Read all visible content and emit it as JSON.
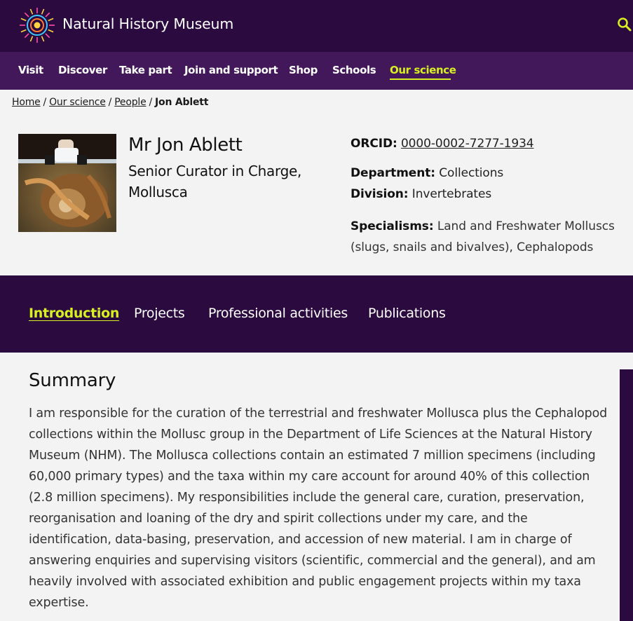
{
  "header": {
    "site_title": "Natural History Museum",
    "logo_icon": "nhm-starburst-logo-icon",
    "search_icon": "search-icon",
    "accent_color": "#d6f022",
    "bg_color": "#2a0a3f"
  },
  "nav": {
    "items": [
      {
        "label": "Visit"
      },
      {
        "label": "Discover"
      },
      {
        "label": "Take part"
      },
      {
        "label": "Join and support"
      },
      {
        "label": "Shop"
      },
      {
        "label": "Schools"
      },
      {
        "label": "Our science",
        "active": true
      }
    ]
  },
  "breadcrumb": {
    "items": [
      "Home",
      "Our science",
      "People"
    ],
    "current": "Jon Ablett"
  },
  "profile": {
    "name": "Mr Jon Ablett",
    "role": "Senior Curator in Charge, Mollusca",
    "orcid_label": "ORCID:",
    "orcid": "0000-0002-7277-1934",
    "department_label": "Department:",
    "department": "Collections",
    "division_label": "Division:",
    "division": "Invertebrates",
    "specialisms_label": "Specialisms:",
    "specialisms": "Land and Freshwater Molluscs (slugs, snails and bivalves), Cephalopods"
  },
  "tabs": [
    {
      "label": "Introduction",
      "active": true
    },
    {
      "label": "Projects"
    },
    {
      "label": "Professional activities"
    },
    {
      "label": "Publications"
    }
  ],
  "summary": {
    "title": "Summary",
    "body": "I am responsible for the curation of the terrestrial and freshwater Mollusca plus the Cephalopod collections within the Mollusc group in the Department of Life Sciences at the Natural History Museum (NHM). The Mollusca collections contain an estimated 7 million specimens (including 60,000 primary types) and the taxa within my care account for around 40% of this collection (2.8 million specimens). My responsibilities include the general care, curation, preservation, reorganisation and loaning of the dry and spirit collections under my care, and the identification, data-basing, preservation, and accession of new material. I am in charge of answering enquiries and supervising visitors (scientific, commercial and the general), and am heavily involved with associated exhibition and public engagement projects within my taxa expertise."
  }
}
